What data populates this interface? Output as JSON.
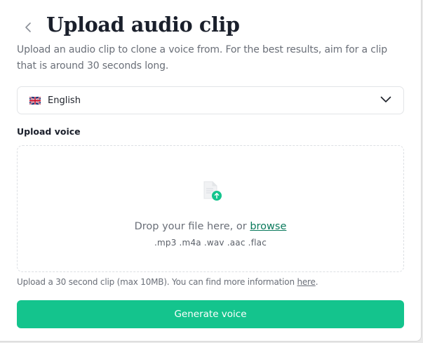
{
  "header": {
    "back_icon": "chevron-left-icon",
    "title": "Upload audio clip",
    "subtitle": "Upload an audio clip to clone a voice from. For the best results, aim for a clip that is around 30 seconds long."
  },
  "language": {
    "flag_icon": "uk-flag-icon",
    "selected": "English",
    "chevron_icon": "chevron-down-icon"
  },
  "upload": {
    "label": "Upload voice",
    "file_icon": "file-upload-icon",
    "drop_prefix": "Drop your file here, or ",
    "browse_label": "browse",
    "formats": ".mp3 .m4a .wav .aac .flac"
  },
  "note": {
    "text": "Upload a 30 second clip (max 10MB). You can find more information ",
    "link": "here",
    "suffix": "."
  },
  "actions": {
    "generate_label": "Generate voice"
  },
  "colors": {
    "accent": "#14c48d",
    "link": "#0a7a5c"
  }
}
